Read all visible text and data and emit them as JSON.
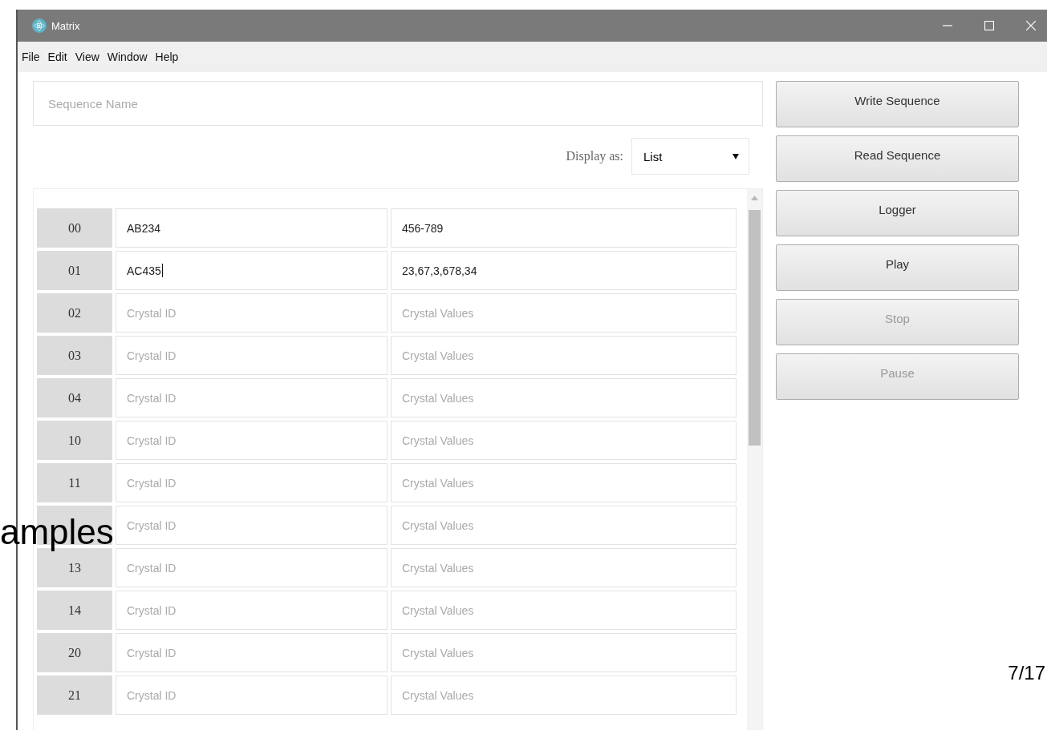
{
  "window": {
    "title": "Matrix"
  },
  "menu": [
    "File",
    "Edit",
    "View",
    "Window",
    "Help"
  ],
  "sequence_name": {
    "placeholder": "Sequence Name"
  },
  "display_as": {
    "label": "Display as:",
    "value": "List"
  },
  "rows": [
    {
      "index": "00",
      "id": {
        "value": "AB234"
      },
      "values": {
        "value": "456-789"
      }
    },
    {
      "index": "01",
      "id": {
        "value": "AC435",
        "focused": true
      },
      "values": {
        "value": "23,67,3,678,34"
      }
    },
    {
      "index": "02",
      "id": {
        "placeholder": "Crystal ID"
      },
      "values": {
        "placeholder": "Crystal Values"
      }
    },
    {
      "index": "03",
      "id": {
        "placeholder": "Crystal ID"
      },
      "values": {
        "placeholder": "Crystal Values"
      }
    },
    {
      "index": "04",
      "id": {
        "placeholder": "Crystal ID"
      },
      "values": {
        "placeholder": "Crystal Values"
      }
    },
    {
      "index": "10",
      "id": {
        "placeholder": "Crystal ID"
      },
      "values": {
        "placeholder": "Crystal Values"
      }
    },
    {
      "index": "11",
      "id": {
        "placeholder": "Crystal ID"
      },
      "values": {
        "placeholder": "Crystal Values"
      }
    },
    {
      "id": {
        "placeholder": "Crystal ID"
      },
      "values": {
        "placeholder": "Crystal Values"
      }
    },
    {
      "index": "13",
      "id": {
        "placeholder": "Crystal ID"
      },
      "values": {
        "placeholder": "Crystal Values"
      }
    },
    {
      "index": "14",
      "id": {
        "placeholder": "Crystal ID"
      },
      "values": {
        "placeholder": "Crystal Values"
      }
    },
    {
      "index": "20",
      "id": {
        "placeholder": "Crystal ID"
      },
      "values": {
        "placeholder": "Crystal Values"
      }
    },
    {
      "index": "21",
      "id": {
        "placeholder": "Crystal ID"
      },
      "values": {
        "placeholder": "Crystal Values"
      }
    }
  ],
  "buttons": [
    {
      "label": "Write Sequence",
      "disabled": false
    },
    {
      "label": "Read Sequence",
      "disabled": false
    },
    {
      "label": "Logger",
      "disabled": false
    },
    {
      "label": "Play",
      "disabled": false
    },
    {
      "label": "Stop",
      "disabled": true
    },
    {
      "label": "Pause",
      "disabled": true
    }
  ],
  "slide_overlay": {
    "heading_fragment": "amples",
    "page_number": "7/17"
  }
}
